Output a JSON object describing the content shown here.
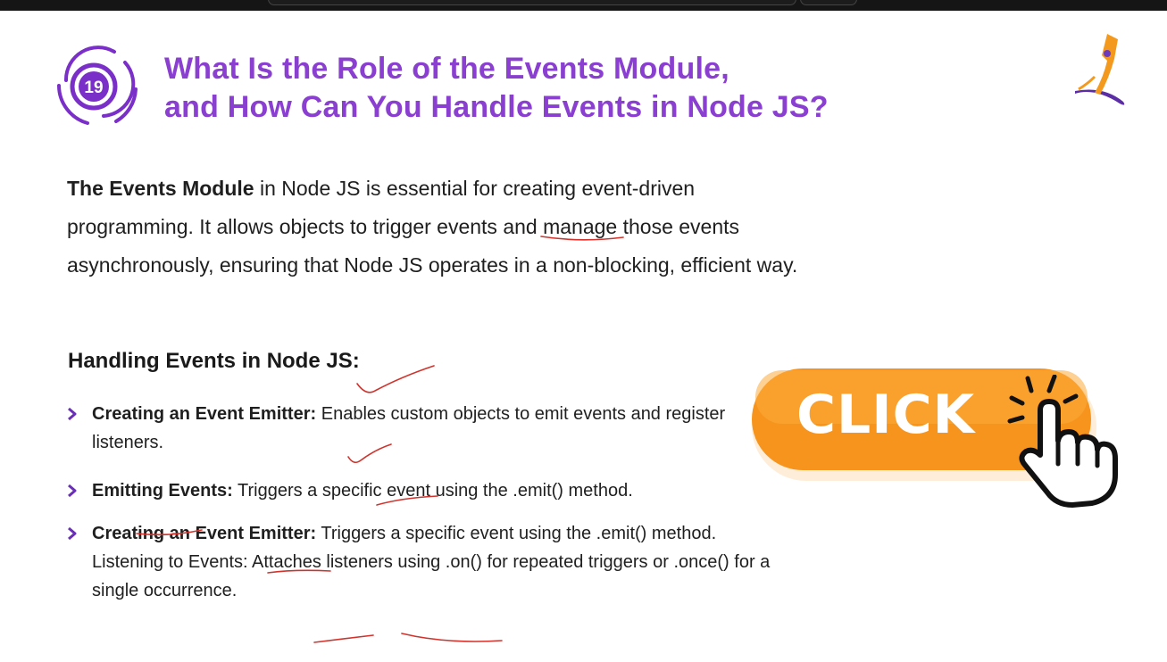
{
  "slide": {
    "number": "19",
    "title_line1": "What Is the Role of the Events Module,",
    "title_line2": "and How Can You Handle Events in Node JS?",
    "intro_bold": "The Events Module",
    "intro_rest": " in Node JS is essential for creating event-driven programming. It allows objects to trigger events and manage those events asynchronously, ensuring that Node JS operates in a non-blocking, efficient way.",
    "subheading": "Handling Events in Node JS:",
    "bullets": [
      {
        "term": "Creating an Event Emitter:",
        "text": " Enables custom objects to emit events and register listeners."
      },
      {
        "term": "Emitting Events:",
        "text": " Triggers a specific event using the .emit() method."
      },
      {
        "term": "Creating an Event Emitter:",
        "text": " Triggers a specific event using the .emit() method. Listening to Events: Attaches listeners using .on() for repeated triggers or .once() for a single occurrence."
      }
    ],
    "cta_label": "CLICK"
  },
  "icons": {
    "bullet": "chevron-right-icon",
    "badge": "numbered-badge-icon",
    "logo": "brand-logo-icon",
    "cursor": "pointer-hand-icon"
  },
  "colors": {
    "title": "#8a3fd1",
    "accent_purple": "#7b2fc9",
    "button_orange": "#f7941d",
    "annotation_red": "#d0332c"
  }
}
